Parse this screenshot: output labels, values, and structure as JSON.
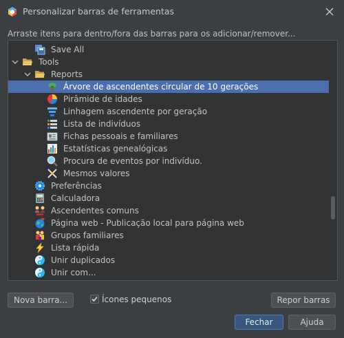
{
  "window": {
    "title": "Personalizar barras de ferramentas",
    "app_icon": "hexagon-app-icon",
    "close_icon": "close-icon"
  },
  "instructions": "Arraste itens para dentro/fora das barras para os adicionar/remover...",
  "tree": {
    "selected_index": 3,
    "items": [
      {
        "label": "Save All",
        "icon": "save-all-icon",
        "expandable": false
      },
      {
        "label": "Tools",
        "icon": "folder-open-icon",
        "expandable": true,
        "expanded": true
      },
      {
        "label": "Reports",
        "icon": "folder-open-icon",
        "expandable": true,
        "expanded": true
      },
      {
        "label": "Árvore de ascendentes circular de 10 gerações",
        "icon": "fan-chart-icon"
      },
      {
        "label": "Pirâmide de idades",
        "icon": "pie-chart-icon"
      },
      {
        "label": "Linhagem ascendente por geração",
        "icon": "lineage-icon"
      },
      {
        "label": "Lista de indivíduos",
        "icon": "list-icon"
      },
      {
        "label": "Fichas pessoais e familiares",
        "icon": "cards-icon"
      },
      {
        "label": "Estatísticas genealógicas",
        "icon": "statistics-icon"
      },
      {
        "label": "Procura de eventos por indivíduo.",
        "icon": "search-icon"
      },
      {
        "label": "Mesmos valores",
        "icon": "duplicates-icon"
      },
      {
        "label": "Preferências",
        "icon": "gear-icon"
      },
      {
        "label": "Calculadora",
        "icon": "calculator-icon"
      },
      {
        "label": "Ascendentes comuns",
        "icon": "common-ancestors-icon"
      },
      {
        "label": "Página web - Publicação local para página web",
        "icon": "web-page-icon"
      },
      {
        "label": "Grupos familiares",
        "icon": "family-groups-icon"
      },
      {
        "label": "Lista rápida",
        "icon": "lightning-icon"
      },
      {
        "label": "Unir duplicados",
        "icon": "merge-icon"
      },
      {
        "label": "Unir com...",
        "icon": "merge-with-icon"
      }
    ]
  },
  "buttons": {
    "new_bar": "Nova barra...",
    "reset_bars": "Repor barras",
    "close": "Fechar",
    "help": "Ajuda"
  },
  "small_icons": {
    "label": "Ícones pequenos",
    "checked": true
  }
}
